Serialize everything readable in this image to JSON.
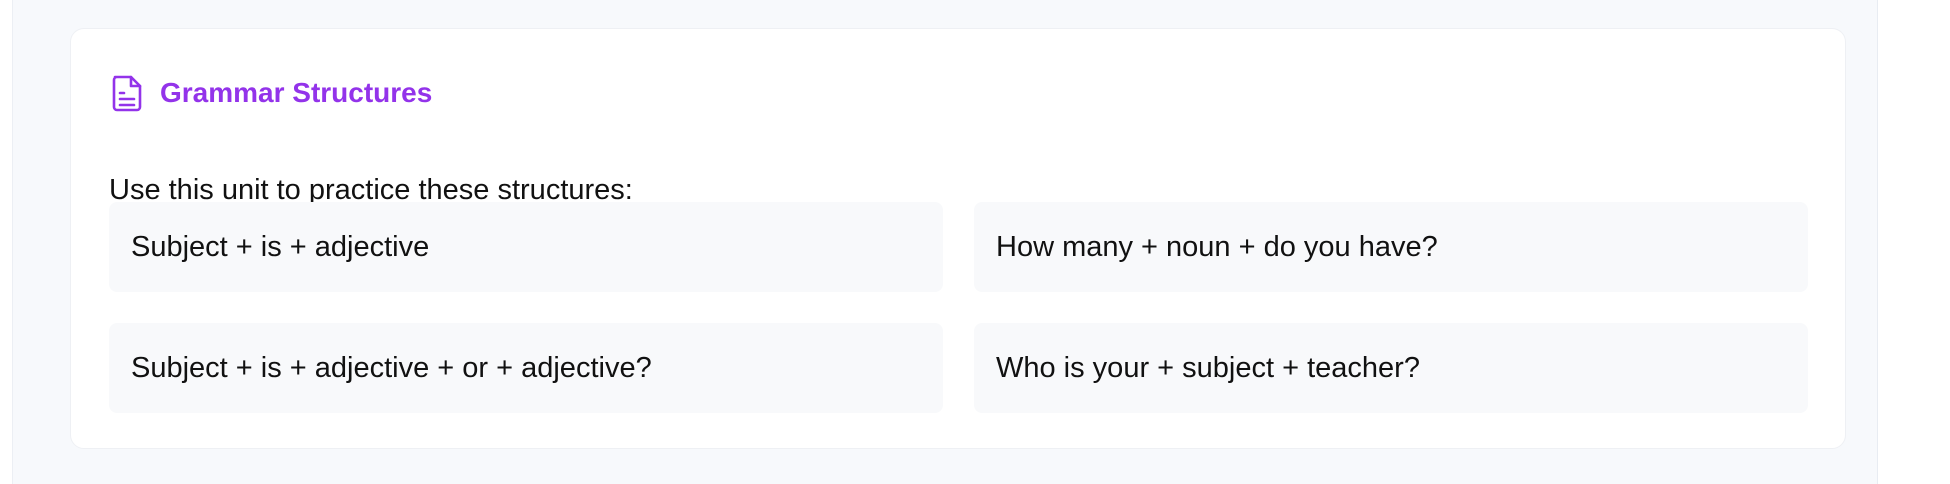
{
  "section": {
    "icon": "document-text-icon",
    "title": "Grammar Structures",
    "intro": "Use this unit to practice these structures:",
    "accent_color": "#9333ea",
    "structures": [
      "Subject + is + adjective",
      "How many + noun + do you have?",
      "Subject + is + adjective + or + adjective?",
      "Who is your + subject + teacher?"
    ]
  }
}
